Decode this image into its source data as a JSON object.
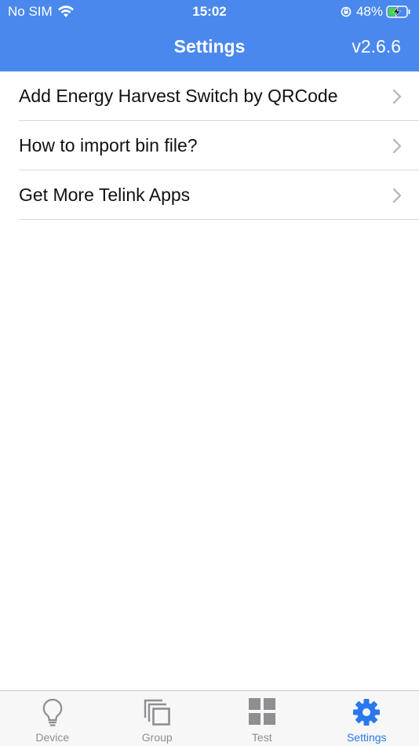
{
  "status_bar": {
    "carrier": "No SIM",
    "time": "15:02",
    "battery_percent": "48%",
    "battery_level": 0.48
  },
  "nav": {
    "title": "Settings",
    "version": "v2.6.6"
  },
  "settings_items": [
    {
      "label": "Add Energy Harvest Switch by QRCode"
    },
    {
      "label": "How to import bin file?"
    },
    {
      "label": "Get More Telink Apps"
    }
  ],
  "tabs": [
    {
      "label": "Device",
      "icon": "lightbulb-icon"
    },
    {
      "label": "Group",
      "icon": "group-icon"
    },
    {
      "label": "Test",
      "icon": "grid-icon"
    },
    {
      "label": "Settings",
      "icon": "gear-icon",
      "active": true
    }
  ],
  "colors": {
    "header": "#4a88ee",
    "tab_active": "#2a78ee",
    "tab_inactive": "#8e8e93"
  }
}
